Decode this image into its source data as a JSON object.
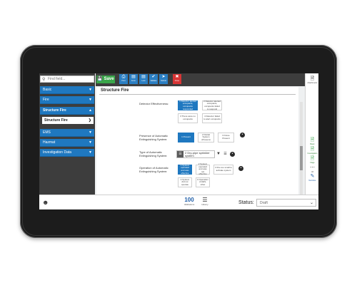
{
  "search": {
    "placeholder": "Find field...",
    "icon": "search-icon"
  },
  "sidebar": {
    "items": [
      {
        "label": "Basic"
      },
      {
        "label": "Fire"
      },
      {
        "label": "Structure Fire"
      },
      {
        "label": "EMS"
      },
      {
        "label": "Hazmat"
      },
      {
        "label": "Investigation Data"
      }
    ],
    "sub_item": "Structure Fire"
  },
  "toolbar": {
    "save_label": "Save",
    "buttons": [
      {
        "label": "Print",
        "icon": "printer-icon"
      },
      {
        "label": "Form",
        "icon": "form-icon"
      },
      {
        "label": "Lock",
        "icon": "lock-icon"
      },
      {
        "label": "Validate",
        "icon": "validate-icon"
      },
      {
        "label": "Submit",
        "icon": "submit-icon"
      }
    ],
    "close_label": "Close"
  },
  "main": {
    "section_title": "Structure Fire",
    "detector": {
      "label": "Detector Effectiveness:",
      "options": [
        "1 Detector alerted occupants, occupants responded",
        "2 Detector alerted occupants, occupants failed to respond",
        "3 There were no occupants",
        "4 Detector failed to alert occupants"
      ]
    },
    "presence": {
      "label": "Presence of Automatic Extinguishing System:",
      "options": [
        "1 Present",
        "2 Partial System (Present)",
        "N None Present"
      ]
    },
    "type": {
      "label": "Type of Automatic Extinguishing System:",
      "value": "2 Dry-pipe sprinkler system"
    },
    "operation": {
      "label": "Operation of Automatic Extinguishing System:",
      "options": [
        "1 System operated and was effective",
        "2 System operated and was not effective",
        "3 Fire too small to activate system",
        "4 System did not operate",
        "0 Operation of AES, other"
      ]
    }
  },
  "right_strip": [
    {
      "label": "Attachments",
      "icon": "document-icon"
    },
    {
      "label": "Basic",
      "icon": "check-doc-icon"
    },
    {
      "label": "Investigation",
      "icon": "check-doc-icon"
    },
    {
      "label": "Flags",
      "icon": "check-doc-icon"
    },
    {
      "label": "All",
      "icon": "more-icon"
    },
    {
      "label": "Narrative",
      "icon": "narrative-icon"
    }
  ],
  "bottom": {
    "count_value": "100",
    "count_label": "Validations",
    "history_label": "History",
    "status_label": "Status:",
    "status_value": "Draft"
  },
  "colors": {
    "accent": "#1f78c0",
    "save": "#3aa64a",
    "close": "#d83535",
    "sidebar_bg": "#3d3d3d"
  }
}
